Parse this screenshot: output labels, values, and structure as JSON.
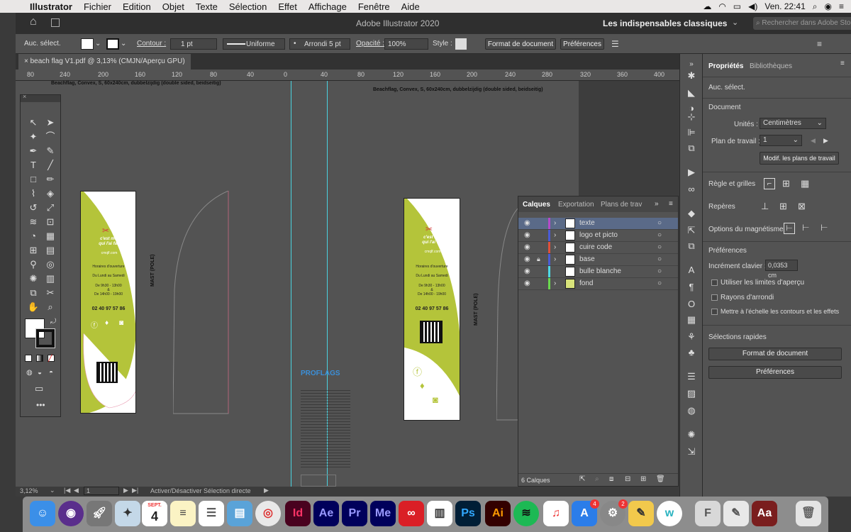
{
  "menubar": {
    "app": "Illustrator",
    "items": [
      "Fichier",
      "Edition",
      "Objet",
      "Texte",
      "Sélection",
      "Effet",
      "Affichage",
      "Fenêtre",
      "Aide"
    ],
    "clock": "Ven. 22:41"
  },
  "titlebar": {
    "title": "Adobe Illustrator 2020",
    "workspace": "Les indispensables classiques",
    "search_placeholder": "Rechercher dans Adobe Stock"
  },
  "control": {
    "selection": "Auc. sélect.",
    "stroke_label": "Contour :",
    "stroke_value": "1 pt",
    "profile": "Uniforme",
    "brush": "Arrondi 5 pt",
    "opacity_label": "Opacité :",
    "opacity_value": "100%",
    "style_label": "Style :",
    "doc_format": "Format de document",
    "preferences": "Préférences"
  },
  "document": {
    "tab": "beach flag V1.pdf @ 3,13% (CMJN/Aperçu GPU)",
    "ruler_ticks": [
      "80",
      "240",
      "200",
      "160",
      "120",
      "80",
      "40",
      "0",
      "40",
      "80",
      "120",
      "160",
      "200",
      "240",
      "280",
      "320",
      "360",
      "400"
    ]
  },
  "artwork": {
    "title_left": "Beachflag, Convex, S, 60x240cm, dubbelzijdig (double sided, beidseitig)",
    "title_right": "Beachflag, Convex, S, 60x240cm, dubbelzijdig (double sided, beidseitig)",
    "mast_label": "MAST (POLE)",
    "brand_line1": "c'est moi",
    "brand_line2": "qui l'ai fait",
    "site": "cmqlf.com",
    "hours_title": "Horaires d'ouverture",
    "days": "Du Lundi au Samedi",
    "hours1": "De 9h30 - 13h00",
    "amp": "&",
    "hours2": "De 14h00 - 19h00",
    "phone": "02 40 97 57 86",
    "proflags": "PROFLAGS"
  },
  "status": {
    "zoom": "3,12%",
    "page": "1",
    "message": "Activer/Désactiver Sélection directe"
  },
  "properties": {
    "tab_props": "Propriétés",
    "tab_libs": "Bibliothèques",
    "selection": "Auc. sélect.",
    "document": "Document",
    "units_label": "Unités :",
    "units_value": "Centimètres",
    "artboard_label": "Plan de travail :",
    "artboard_value": "1",
    "edit_artboards": "Modif. les plans de travail",
    "rulers_grids": "Règle et grilles",
    "guides": "Repères",
    "snap": "Options du magnétisme",
    "prefs": "Préférences",
    "increment_label": "Incrément clavier :",
    "increment_value": "0,0353 cm",
    "chk_preview": "Utiliser les limites d'aperçu",
    "chk_round": "Rayons d'arrondi",
    "chk_scale": "Mettre à l'échelle les contours et les effets",
    "quick": "Sélections rapides",
    "quick_doc": "Format de document",
    "quick_prefs": "Préférences"
  },
  "layers": {
    "tab_layers": "Calques",
    "tab_export": "Exportation",
    "tab_artboards": "Plans de trav",
    "rows": [
      {
        "name": "texte",
        "color": "#b54ac9"
      },
      {
        "name": "logo et picto",
        "color": "#4a5bd6"
      },
      {
        "name": "cuire code",
        "color": "#e0503a"
      },
      {
        "name": "base",
        "color": "#4a5bd6"
      },
      {
        "name": "bulle blanche",
        "color": "#4ed8e6"
      },
      {
        "name": "fond",
        "color": "#6ad94e"
      }
    ],
    "count": "6 Calques"
  },
  "dock": {
    "calendar_month": "SEPT.",
    "calendar_day": "4",
    "badge_1": "4",
    "badge_2": "2",
    "apps": [
      "Id",
      "Ae",
      "Pr",
      "Me",
      "Ps",
      "Ai"
    ]
  },
  "colors": {
    "flag_green": "#b4c43a",
    "accent": "#4f7bd6"
  }
}
